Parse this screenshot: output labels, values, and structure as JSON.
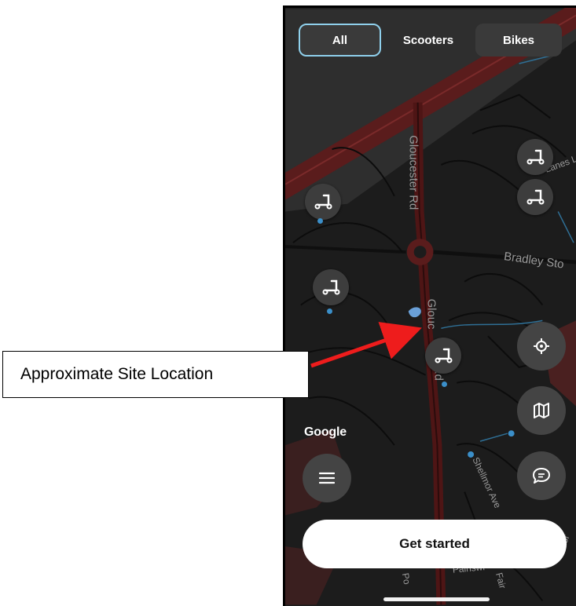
{
  "filters": {
    "all_label": "All",
    "scooters_label": "Scooters",
    "bikes_label": "Bikes",
    "selected": "All"
  },
  "map": {
    "street_labels": [
      "Gloucester Rd",
      "Glouc",
      "Rd",
      "Bradley Sto",
      "Lanes Ln",
      "Shellmor Ave",
      "Painswi",
      "Fair",
      "Po",
      "tor"
    ],
    "attribution": "Google"
  },
  "annotation": {
    "label": "Approximate Site Location"
  },
  "cta": {
    "label": "Get started"
  },
  "icons": {
    "vehicle_pin": "scooter-icon",
    "locate": "crosshair-icon",
    "map_toggle": "map-icon",
    "chat": "chat-bubble-icon",
    "menu": "hamburger-menu-icon"
  },
  "colors": {
    "map_background": "#1e1e1e",
    "road_red": "#5a1c1c",
    "chip_active_border": "#8fd0ec",
    "pin_dot": "#3b8fc9",
    "arrow": "#ee1c1c"
  }
}
